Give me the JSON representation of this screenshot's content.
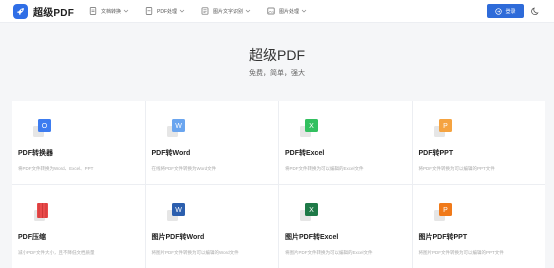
{
  "header": {
    "logo_text": "超级PDF",
    "nav": [
      {
        "label": "文档转换",
        "icon": "document-convert-icon"
      },
      {
        "label": "PDF处理",
        "icon": "pdf-process-icon"
      },
      {
        "label": "图片文字识别",
        "icon": "image-ocr-icon"
      },
      {
        "label": "图片处理",
        "icon": "image-process-icon"
      }
    ],
    "login_label": "登录",
    "accent": "#2e6bd9"
  },
  "hero": {
    "title": "超级PDF",
    "subtitle": "免费，简单，强大"
  },
  "tools": [
    {
      "title": "PDF转换器",
      "desc": "将PDF文件转换为Word、Excel、PPT",
      "icon": "office-convert-icon",
      "color": "#3d7cf0",
      "letter": "O"
    },
    {
      "title": "PDF转Word",
      "desc": "在线将PDF文件转换为Word文件",
      "icon": "word-icon",
      "color": "#6aa5ef",
      "letter": "W"
    },
    {
      "title": "PDF转Excel",
      "desc": "将PDF文件转换为可以编辑的Excel文件",
      "icon": "excel-icon",
      "color": "#33c060",
      "letter": "X"
    },
    {
      "title": "PDF转PPT",
      "desc": "将PDF文件转换为可以编辑的PPT文件",
      "icon": "ppt-icon",
      "color": "#f5a340",
      "letter": "P"
    },
    {
      "title": "PDF压缩",
      "desc": "减小PDF文件大小，且不降低文档质量",
      "icon": "compress-icon",
      "color": "#e94b4b",
      "letter": ""
    },
    {
      "title": "图片PDF转Word",
      "desc": "将图片PDF文件转换为可以编辑的Word文件",
      "icon": "word-icon",
      "color": "#2c5fae",
      "letter": "W"
    },
    {
      "title": "图片PDF转Excel",
      "desc": "将图片PDF文件转换为可以编辑的Excel文件",
      "icon": "excel-icon",
      "color": "#1f7a48",
      "letter": "X"
    },
    {
      "title": "图片PDF转PPT",
      "desc": "将图片PDF文件转换为可以编辑的PPT文件",
      "icon": "ppt-icon",
      "color": "#f07a1a",
      "letter": "P"
    }
  ]
}
